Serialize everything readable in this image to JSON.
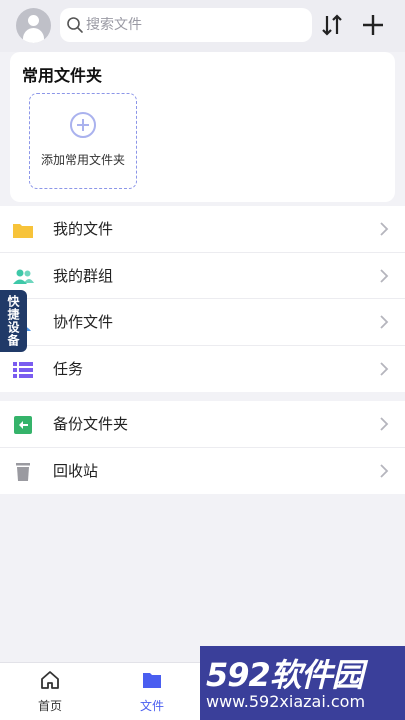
{
  "header": {
    "search_placeholder": "搜索文件",
    "icons": {
      "avatar": "user-avatar",
      "search": "search-icon",
      "sort": "sort-icon",
      "add": "plus-icon"
    }
  },
  "favorites": {
    "title": "常用文件夹",
    "add_label": "添加常用文件夹"
  },
  "main_list": [
    {
      "label": "我的文件",
      "icon": "folder-icon",
      "color": "#f7c33a"
    },
    {
      "label": "我的群组",
      "icon": "group-icon",
      "color": "#3ec8a8"
    },
    {
      "label": "协作文件",
      "icon": "collab-icon",
      "color": "#4a90e2"
    },
    {
      "label": "任务",
      "icon": "task-list-icon",
      "color": "#7a5cf0"
    }
  ],
  "secondary_list": [
    {
      "label": "备份文件夹",
      "icon": "backup-icon",
      "color": "#35b36a"
    },
    {
      "label": "回收站",
      "icon": "trash-icon",
      "color": "#9a9aa0"
    }
  ],
  "side_tag": {
    "text": "快捷设备"
  },
  "bottom_nav": [
    {
      "label": "首页",
      "icon": "home-icon",
      "active": false
    },
    {
      "label": "文件",
      "icon": "folder-icon",
      "active": true
    }
  ],
  "watermark": {
    "brand": "592软件园",
    "url": "www.592xiazai.com"
  },
  "colors": {
    "accent": "#4a5ef0",
    "dashed_border": "#8c96e8"
  }
}
